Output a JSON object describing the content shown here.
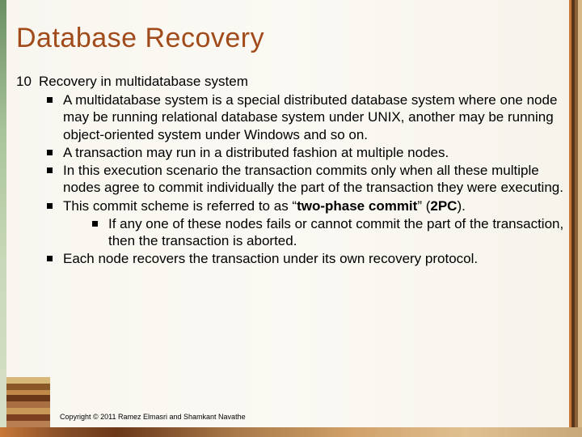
{
  "title": "Database Recovery",
  "section_number": "10",
  "section_title": "Recovery in multidatabase system",
  "bullets": [
    {
      "text": "A multidatabase system is a special distributed database system where one node may be running relational database system under UNIX, another may be running object-oriented system under Windows and so on."
    },
    {
      "text": "A transaction may run in a distributed fashion at multiple nodes."
    },
    {
      "text": "In this execution scenario the transaction commits only when all these multiple nodes agree to commit individually the part of the transaction they were executing."
    },
    {
      "pre": "This commit scheme is  referred to as “",
      "bold1": "two-phase commit",
      "mid": "” (",
      "bold2": "2PC",
      "post": ").",
      "sub": [
        "If any one of these nodes fails or cannot commit the part of the transaction, then the transaction is aborted."
      ]
    },
    {
      "text": "Each node recovers the transaction under its own recovery protocol."
    }
  ],
  "copyright": "Copyright © 2011 Ramez Elmasri and Shamkant Navathe"
}
